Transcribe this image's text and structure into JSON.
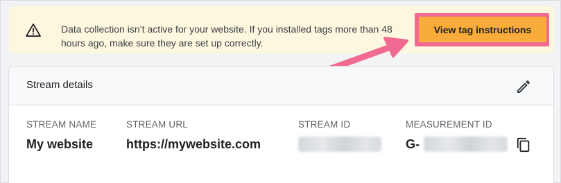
{
  "banner": {
    "icon": "warning-icon",
    "message": "Data collection isn’t active for your website. If you installed tags more than 48 hours ago, make sure they are set up correctly.",
    "button_label": "View tag instructions",
    "button_color": "#f9ab3b",
    "highlight_color": "#f06a91",
    "background": "#fef7e0"
  },
  "stream": {
    "title": "Stream details",
    "edit_icon": "pencil-icon",
    "copy_icon": "copy-icon",
    "fields": [
      {
        "label": "STREAM NAME",
        "value": "My website"
      },
      {
        "label": "STREAM URL",
        "value": "https://mywebsite.com"
      },
      {
        "label": "STREAM ID",
        "value": ""
      },
      {
        "label": "MEASUREMENT ID",
        "value": "G-"
      }
    ]
  },
  "annotation": {
    "icon": "arrow-icon",
    "color": "#f06a91"
  }
}
